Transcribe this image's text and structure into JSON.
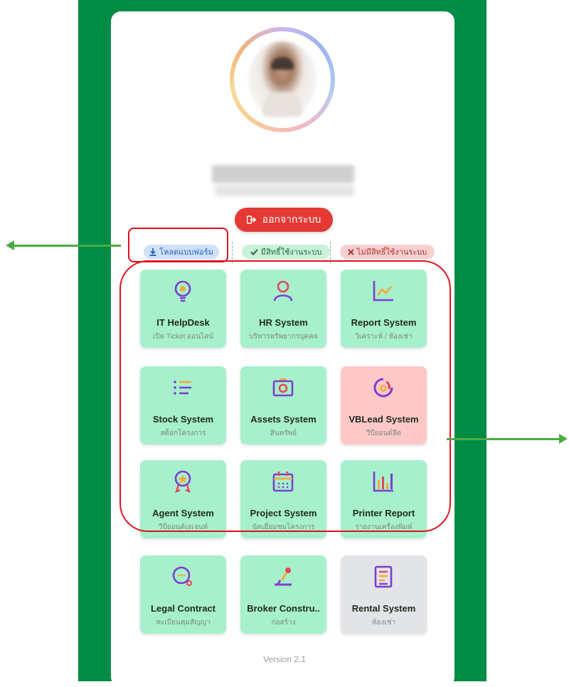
{
  "user": {
    "name": "",
    "subtitle": ""
  },
  "logout": {
    "label": "ออกจากระบบ",
    "icon": "logout-icon"
  },
  "legend": {
    "download": "โหลดแบบฟอร์ม",
    "allowed": "มีสิทธิ์ใช้งานระบบ",
    "denied": "ไม่มีสิทธิ์ใช้งานระบบ"
  },
  "apps": [
    {
      "title": "IT HelpDesk",
      "subtitle": "เปิด Ticket ออนไลน์",
      "icon": "lightbulb-icon",
      "status": "allowed"
    },
    {
      "title": "HR System",
      "subtitle": "บริหารทรัพยากรบุคคล",
      "icon": "person-icon",
      "status": "allowed"
    },
    {
      "title": "Report System",
      "subtitle": "วิเคราะห์ / ห้องเช่า",
      "icon": "line-chart-icon",
      "status": "allowed"
    },
    {
      "title": "Stock System",
      "subtitle": "สต็อกโครงการ",
      "icon": "list-icon",
      "status": "allowed"
    },
    {
      "title": "Assets System",
      "subtitle": "สินทรัพย์",
      "icon": "camera-icon",
      "status": "allowed"
    },
    {
      "title": "VBLead System",
      "subtitle": "วีบียอนด์ลีด",
      "icon": "donut-chart-icon",
      "status": "denied"
    },
    {
      "title": "Agent System",
      "subtitle": "วีบียอนด์เอเจนท์",
      "icon": "badge-icon",
      "status": "allowed"
    },
    {
      "title": "Project System",
      "subtitle": "นัดเยี่ยมชมโครงการ",
      "icon": "calendar-icon",
      "status": "allowed"
    },
    {
      "title": "Printer Report",
      "subtitle": "รายงานเครื่องพิมพ์",
      "icon": "bar-chart-icon",
      "status": "allowed"
    },
    {
      "title": "Legal Contract",
      "subtitle": "ทะเบียนคุมสัญญา",
      "icon": "chat-search-icon",
      "status": "allowed"
    },
    {
      "title": "Broker Constru..",
      "subtitle": "ก่อสร้าง",
      "icon": "broker-icon",
      "status": "allowed"
    },
    {
      "title": "Rental System",
      "subtitle": "ห้องเช่า",
      "icon": "document-icon",
      "status": "neutral"
    }
  ],
  "footer": {
    "version": "Version 2.1"
  },
  "colors": {
    "background": "#008c44",
    "allowed": "#a7f0cc",
    "denied": "#ffc8c8",
    "neutral": "#e3e4e8",
    "logout": "#e53935",
    "annotation": "#e0101c",
    "arrow": "#4cab43"
  }
}
